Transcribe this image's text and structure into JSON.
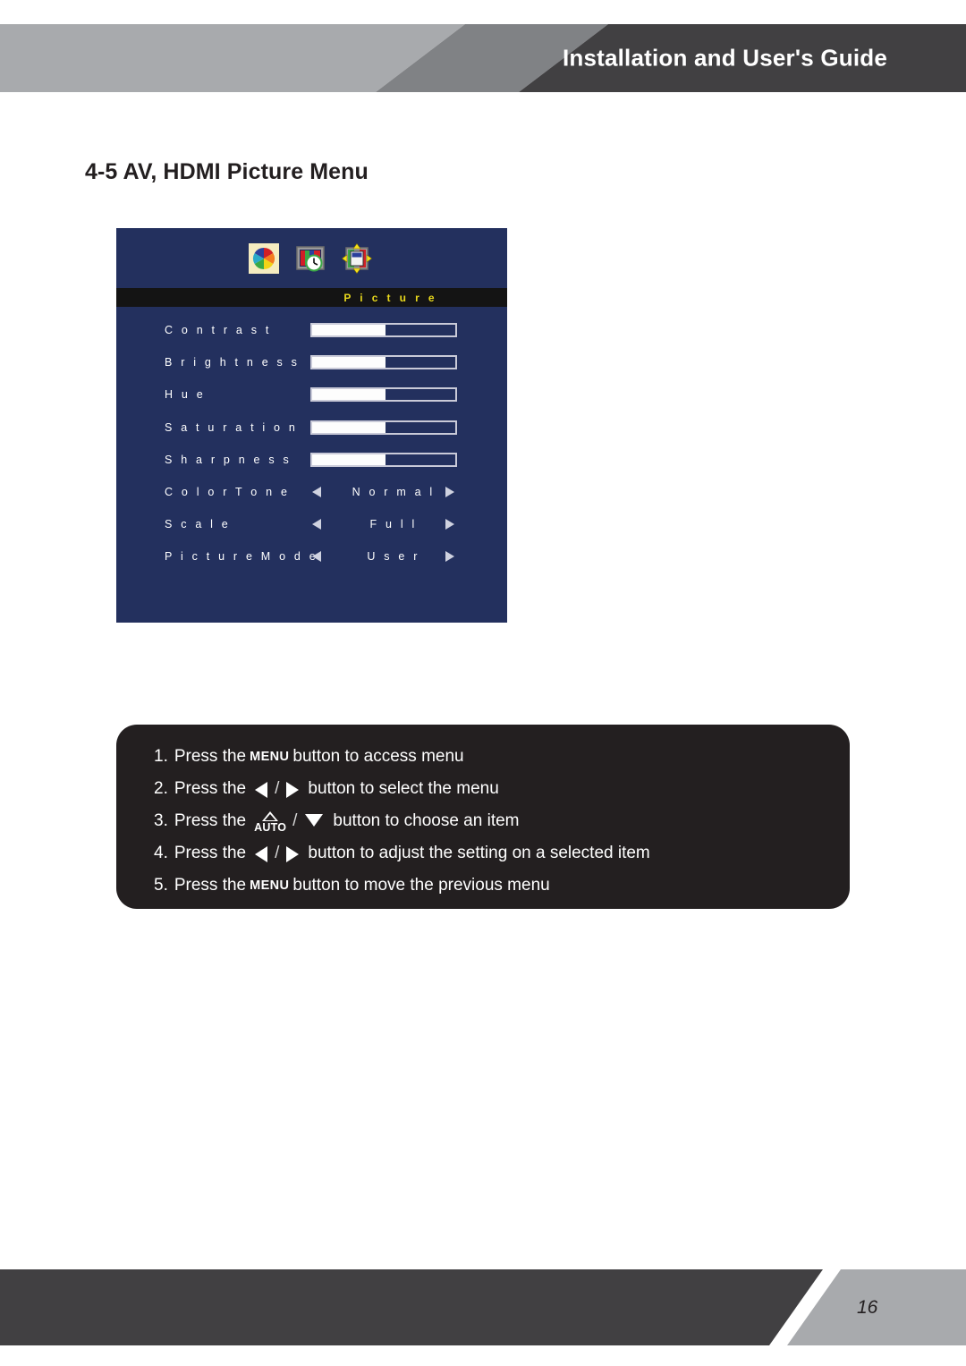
{
  "header": {
    "title": "Installation and User's Guide"
  },
  "section": {
    "heading": "4-5 AV, HDMI Picture Menu"
  },
  "osd": {
    "title": "P i c t u r e",
    "icons": [
      {
        "name": "color-wheel-icon"
      },
      {
        "name": "screen-clock-icon"
      },
      {
        "name": "screen-position-icon"
      }
    ],
    "slider_rows": [
      {
        "label": "C o n t r a s t",
        "value": 52
      },
      {
        "label": "B r i g h t n e s s",
        "value": 52
      },
      {
        "label": "H u e",
        "value": 52
      },
      {
        "label": "S a t u r a t i o n",
        "value": 52
      },
      {
        "label": "S h a r p n e s s",
        "value": 52
      }
    ],
    "select_rows": [
      {
        "label": "C o l o r  T o n e",
        "value": "N o r m a l"
      },
      {
        "label": "S c a l e",
        "value": "F u l l"
      },
      {
        "label": "P i c t u r e  M o d e",
        "value": "U s e r"
      }
    ],
    "colors": {
      "panel_background": "#23305e",
      "title_bar_background": "#141414",
      "title_text": "#e8d81c"
    }
  },
  "instructions": [
    {
      "number": "1.",
      "prefix": "Press the",
      "glyph": "menu-button",
      "glyph_label": "MENU",
      "suffix": "button to access menu"
    },
    {
      "number": "2.",
      "prefix": "Press the",
      "glyph": "left-right-arrows",
      "separator": "/",
      "suffix": "button to select the menu"
    },
    {
      "number": "3.",
      "prefix": "Press the",
      "glyph": "auto-up-down-arrows",
      "glyph_label": "AUTO",
      "separator": "/",
      "suffix": "button to choose an item"
    },
    {
      "number": "4.",
      "prefix": "Press the",
      "glyph": "left-right-arrows",
      "separator": "/",
      "suffix": "button to adjust the setting on a selected item"
    },
    {
      "number": "5.",
      "prefix": "Press the",
      "glyph": "menu-button",
      "glyph_label": "MENU",
      "suffix": "button to move the previous menu"
    }
  ],
  "footer": {
    "page_number": "16"
  },
  "theme": {
    "band_light": "#a8aaad",
    "band_mid": "#808285",
    "band_dark": "#414042",
    "text_dark": "#231f20"
  }
}
